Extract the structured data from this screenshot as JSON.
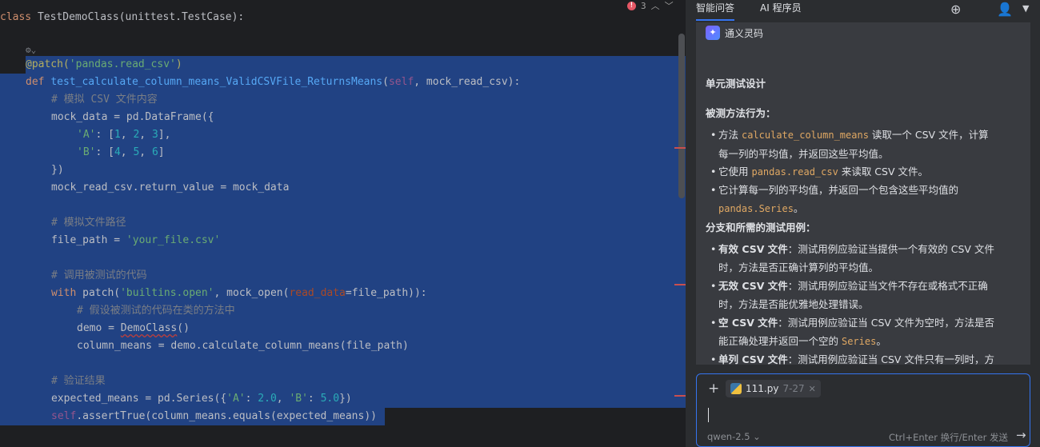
{
  "editor": {
    "class_line": {
      "kw": "class",
      "name": "TestDemoClass",
      "args": "(unittest.TestCase):"
    },
    "gutter_hint": "⚙⌄",
    "lines": {
      "decorator": "@patch(",
      "decorator_arg": "'pandas.read_csv'",
      "decorator_end": ")",
      "def_kw": "def",
      "func_name": "test_calculate_column_means_ValidCSVFile_ReturnsMeans",
      "def_open": "(",
      "def_self": "self",
      "def_rest": ", mock_read_csv):",
      "c1": "# 模拟 CSV 文件内容",
      "l2": "mock_data = pd.DataFrame({",
      "l3_key": "'A'",
      "l3_mid": ": [",
      "l3_n1": "1",
      "l3_n2": "2",
      "l3_n3": "3",
      "l4_key": "'B'",
      "l4_n1": "4",
      "l4_n2": "5",
      "l4_n3": "6",
      "l5": "})",
      "l6": "mock_read_csv.return_value = mock_data",
      "c2": "# 模拟文件路径",
      "l8_a": "file_path = ",
      "l8_b": "'your_file.csv'",
      "c3": "# 调用被测试的代码",
      "l10_kw": "with",
      "l10_a": " patch(",
      "l10_str": "'builtins.open'",
      "l10_b": ", mock_open(",
      "l10_param": "read_data",
      "l10_c": "=file_path)):",
      "c4": "# 假设被测试的代码在类的方法中",
      "l12_a": "demo = ",
      "l12_b": "DemoClass",
      "l12_c": "()",
      "l13": "column_means = demo.calculate_column_means(file_path)",
      "c5": "# 验证结果",
      "l15_a": "expected_means = pd.Series({",
      "l15_k1": "'A'",
      "l15_v1": "2.0",
      "l15_k2": "'B'",
      "l15_v2": "5.0",
      "l15_end": "})",
      "l16_self": "self",
      "l16_rest": ".assertTrue(column_means.equals(expected_means))"
    },
    "error_count": "3"
  },
  "panel": {
    "tabs": [
      "智能问答",
      "AI 程序员"
    ],
    "assistant_name": "通义灵码",
    "heading": "单元测试设计",
    "behavior_title": "被测方法行为：",
    "behavior": [
      {
        "a": "方法 ",
        "code": "calculate_column_means",
        "b": " 读取一个 CSV 文件，计算",
        "c": "每一列的平均值，并返回这些平均值。"
      },
      {
        "a": "它使用 ",
        "code": "pandas.read_csv",
        "b": " 来读取 CSV 文件。"
      },
      {
        "a": "它计算每一列的平均值，并返回一个包含这些平均值的",
        "code": "pandas.Series",
        "b": "。"
      }
    ],
    "cases_title": "分支和所需的测试用例：",
    "cases": [
      {
        "bold": "有效 CSV 文件",
        "text": "：测试用例应验证当提供一个有效的 CSV 文件",
        "text2": "时，方法是否正确计算列的平均值。"
      },
      {
        "bold": "无效 CSV 文件",
        "text": "：测试用例应验证当文件不存在或格式不正确",
        "text2": "时，方法是否能优雅地处理错误。"
      },
      {
        "bold": "空 CSV 文件",
        "text": "：测试用例应验证当 CSV 文件为空时，方法是否",
        "text2": "能正确处理并返回一个空的 ",
        "code": "Series",
        "text3": "。"
      },
      {
        "bold": "单列 CSV 文件",
        "text": "：测试用例应验证当 CSV 文件只有一列时，方"
      }
    ],
    "input": {
      "file_chip": "111.py",
      "file_range": "7-27",
      "model": "qwen-2.5",
      "hint": "Ctrl+Enter 换行/Enter 发送"
    }
  }
}
